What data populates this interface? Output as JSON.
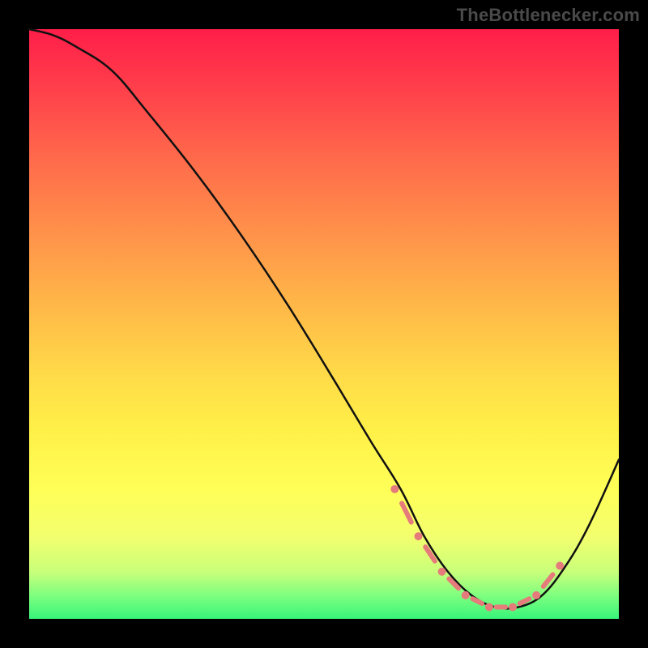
{
  "watermark": {
    "text": "TheBottlenecker.com"
  },
  "chart_data": {
    "type": "line",
    "title": "",
    "xlabel": "",
    "ylabel": "",
    "xlim": [
      0,
      100
    ],
    "ylim": [
      0,
      100
    ],
    "grid": false,
    "legend": false,
    "series": [
      {
        "name": "curve",
        "x": [
          0,
          4,
          8,
          14,
          20,
          28,
          36,
          44,
          52,
          58,
          63,
          67,
          71,
          75,
          79,
          83,
          87,
          91,
          95,
          100
        ],
        "values": [
          100,
          99,
          97,
          93,
          86,
          76,
          65,
          53,
          40,
          30,
          22,
          14,
          8,
          4,
          2,
          2,
          4,
          9,
          16,
          27
        ]
      }
    ],
    "markers": {
      "name": "highlight-dots",
      "x": [
        62,
        66,
        70,
        74,
        78,
        82,
        86,
        90
      ],
      "values": [
        22,
        14,
        8,
        4,
        2,
        2,
        4,
        9
      ]
    }
  }
}
